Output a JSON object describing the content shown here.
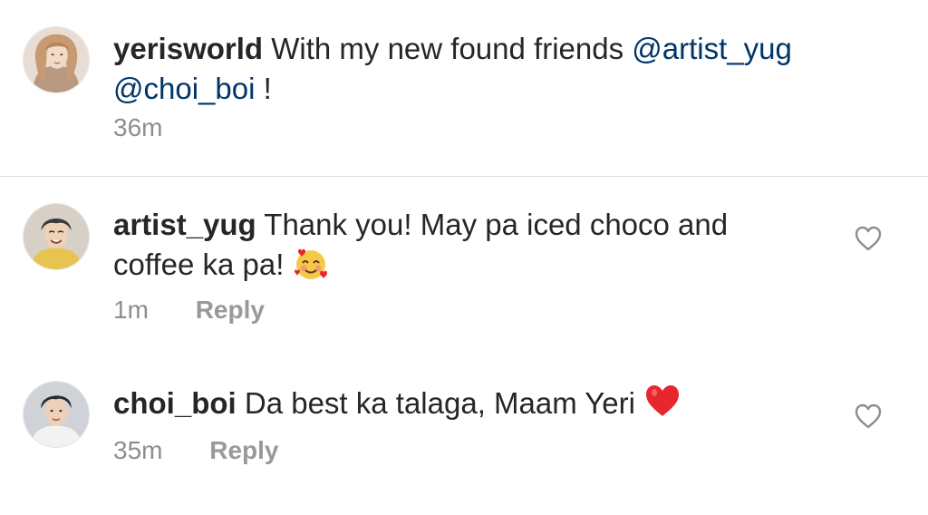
{
  "caption": {
    "username": "yerisworld",
    "text_before": "With my new found friends",
    "mention_1": "@artist_yug",
    "mention_2": "@choi_boi",
    "text_after": "!",
    "time": "36m",
    "avatar_icon": "profile-photo-yerisworld"
  },
  "comments": [
    {
      "username": "artist_yug",
      "text": "Thank you! May pa iced choco and",
      "text_line2": "coffee ka pa!",
      "emoji": "smiling-face-with-hearts",
      "time": "1m",
      "reply_label": "Reply",
      "like_icon": "heart-outline-icon"
    },
    {
      "username": "choi_boi",
      "text": "Da best ka talaga, Maam Yeri",
      "emoji": "red-heart",
      "time": "35m",
      "reply_label": "Reply",
      "like_icon": "heart-outline-icon"
    }
  ],
  "colors": {
    "text": "#262626",
    "mention": "#003569",
    "meta": "#8e8e8e",
    "divider": "#dbdbdb",
    "heart_red": "#e8262d"
  }
}
